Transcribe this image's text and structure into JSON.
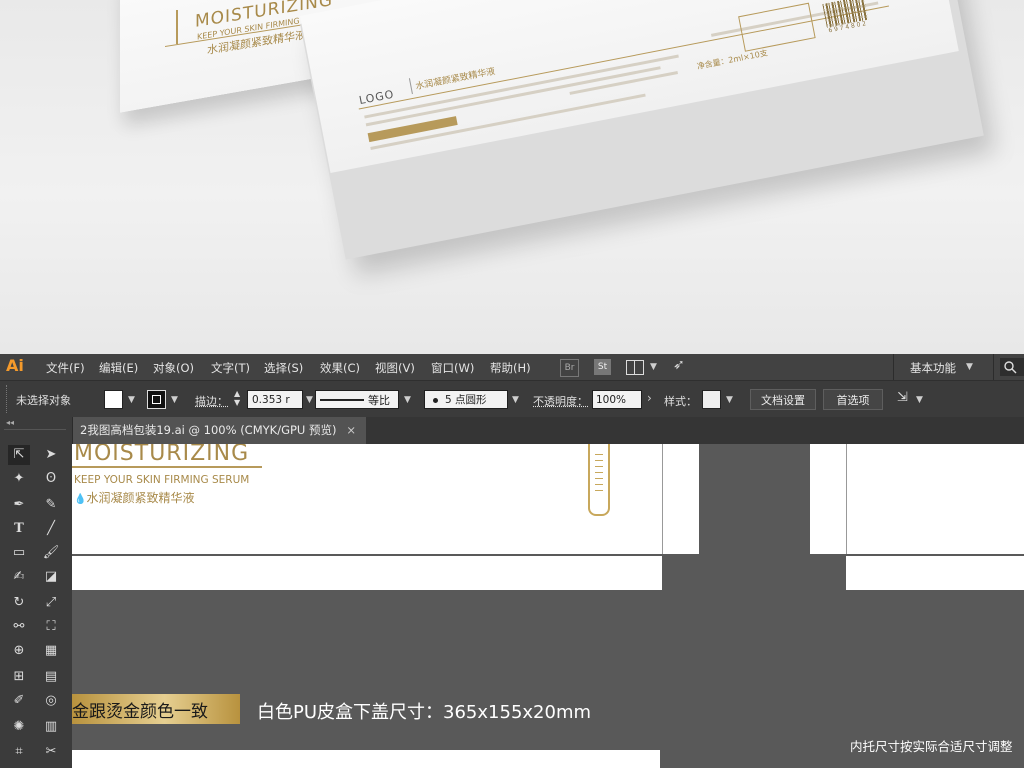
{
  "mockup": {
    "top_box": {
      "brand": "MOISTURIZING",
      "subtitle": "KEEP YOUR SKIN FIRMING SERUM",
      "cn_name": "水润凝颜紧致精华液"
    },
    "main_box": {
      "logo": "LOGO",
      "cn_name": "水润凝颜紧致精华液",
      "net_content": "净含量：2ml×10支",
      "barcode_digits": "6 9 7 4 8 0 2"
    }
  },
  "menubar": {
    "app_icon": "Ai",
    "items": [
      "文件(F)",
      "编辑(E)",
      "对象(O)",
      "文字(T)",
      "选择(S)",
      "效果(C)",
      "视图(V)",
      "窗口(W)",
      "帮助(H)"
    ],
    "bridge": "Br",
    "stock": "St",
    "workspace": "基本功能"
  },
  "control_bar": {
    "selection_label": "未选择对象",
    "stroke_label": "描边：",
    "stroke_value": "0.353 r",
    "stroke_profile": "等比",
    "brush_label": "5 点圆形",
    "opacity_label": "不透明度：",
    "opacity_value": "100%",
    "style_label": "样式：",
    "doc_setup": "文档设置",
    "preferences": "首选项"
  },
  "document": {
    "tab_title": "2我图高档包装19.ai @ 100% (CMYK/GPU 预览)",
    "close_glyph": "×"
  },
  "artboard": {
    "brand": "MOISTURIZING",
    "subtitle": "KEEP YOUR SKIN FIRMING SERUM",
    "cn_name": "水润凝颜紧致精华液",
    "gold_note": "金跟烫金颜色一致",
    "size_note": "白色PU皮盒下盖尺寸：365x155x20mm",
    "tray_note": "内托尺寸按实际合适尺寸调整"
  },
  "colors": {
    "accent_gold": "#a88a4a",
    "ui_dark": "#424242",
    "canvas": "#595959"
  }
}
